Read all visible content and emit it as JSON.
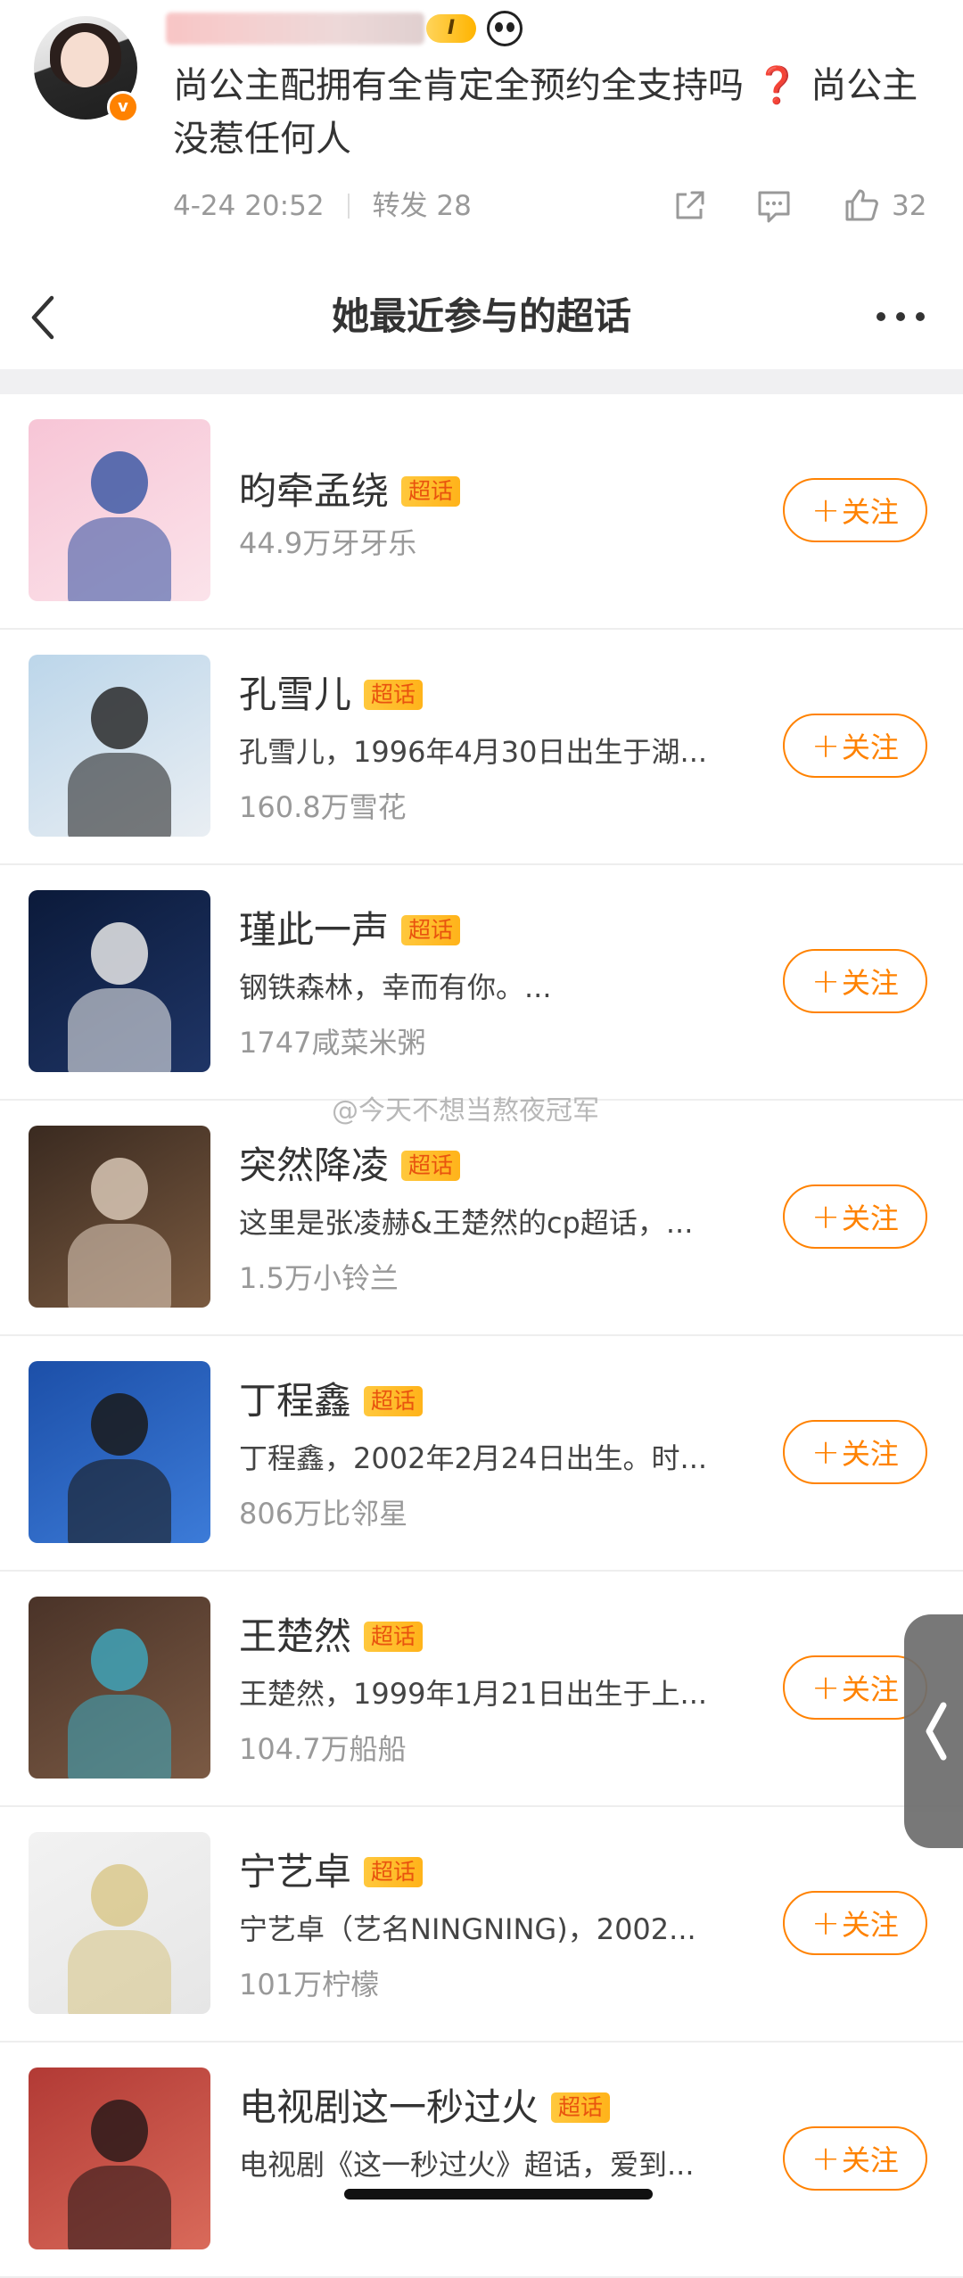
{
  "post": {
    "verified_badge": "v",
    "level_badge": "I",
    "text_part1": "尚公主配拥有全肯定全预约全支持吗",
    "text_emoji": "❓",
    "text_part2": "尚公主没惹任何人",
    "time": "4-24 20:52",
    "repost": "转发 28",
    "like_count": "32",
    "icons": [
      "share-icon",
      "comment-icon",
      "like-icon"
    ]
  },
  "sheet": {
    "title": "她最近参与的超话",
    "icons": [
      "back-icon",
      "more-icon"
    ]
  },
  "tag_label": "超话",
  "follow_label": "关注",
  "follow_plus": "+",
  "topics": [
    {
      "name": "昀牵孟绕",
      "desc": "",
      "fans": "44.9万牙牙乐",
      "thumb": [
        "#f7c5d6",
        "#fbe3ea",
        "#3f5aa6"
      ]
    },
    {
      "name": "孔雪儿",
      "desc": "孔雪儿，1996年4月30日出生于湖...",
      "fans": "160.8万雪花",
      "thumb": [
        "#bcd6ea",
        "#e9eef3",
        "#2a2a2a"
      ]
    },
    {
      "name": "瑾此一声",
      "desc": "钢铁森林，幸而有你。...",
      "fans": "1747咸菜米粥",
      "thumb": [
        "#0b1a3a",
        "#1f3566",
        "#e8e8e8"
      ]
    },
    {
      "name": "突然降凌",
      "desc": "这里是张凌赫&王楚然的cp超话，...",
      "fans": "1.5万小铃兰",
      "thumb": [
        "#3a2a20",
        "#7a5a40",
        "#d8c7b5"
      ]
    },
    {
      "name": "丁程鑫",
      "desc": "丁程鑫，2002年2月24日出生。时...",
      "fans": "806万比邻星",
      "thumb": [
        "#1c4fa8",
        "#3c7bd8",
        "#1a1a1a"
      ]
    },
    {
      "name": "王楚然",
      "desc": "王楚然，1999年1月21日出生于上...",
      "fans": "104.7万船船",
      "thumb": [
        "#4a3328",
        "#7b5a44",
        "#3fa3b8"
      ]
    },
    {
      "name": "宁艺卓",
      "desc": "宁艺卓（艺名NINGNING)，2002...",
      "fans": "101万柠檬",
      "thumb": [
        "#f2f2f2",
        "#e6e6e6",
        "#d9c88c"
      ]
    },
    {
      "name": "电视剧这一秒过火",
      "desc": "电视剧《这一秒过火》超话，爱到...",
      "fans": "",
      "thumb": [
        "#b23a35",
        "#d96a5a",
        "#2b1a1a"
      ]
    }
  ],
  "watermark": "@今天不想当熬夜冠军",
  "colors": {
    "accent": "#ff8200",
    "tag_bg": "#ffc83d",
    "tag_text": "#e8530e",
    "divider": "#f0f0f2"
  }
}
